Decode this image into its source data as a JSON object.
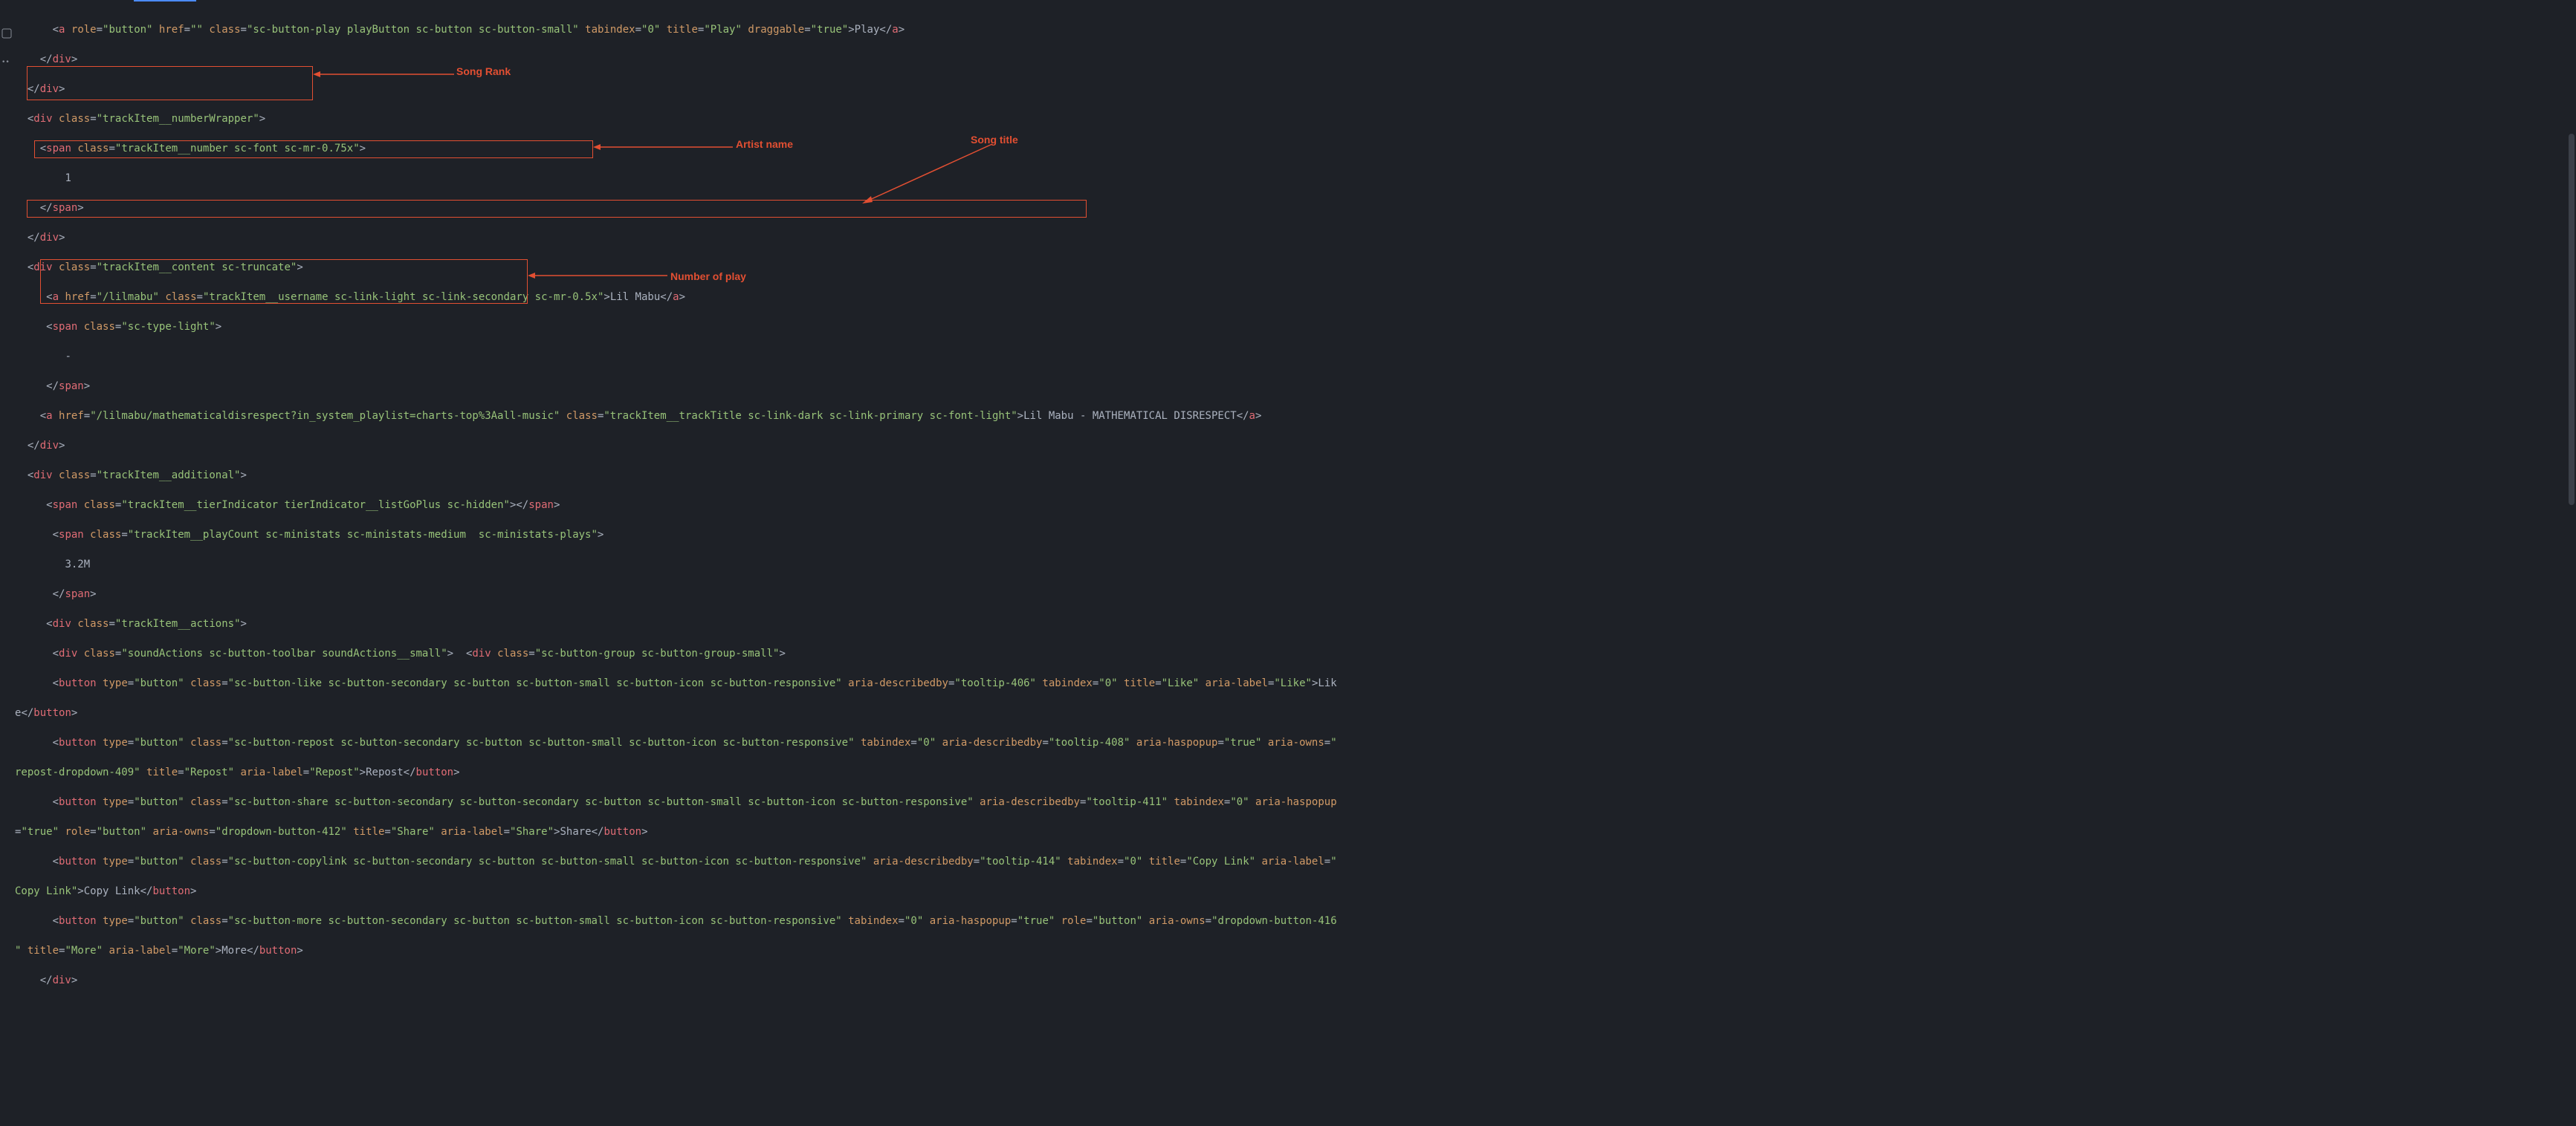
{
  "annotations": {
    "song_rank": "Song Rank",
    "artist_name": "Artist name",
    "song_title": "Song title",
    "play_count": "Number of play"
  },
  "code": {
    "l0": {
      "ind": "      ",
      "open": "<",
      "tag": "a",
      "attrs": " role=\"button\" href=\"\" class=\"sc-button-play playButton sc-button sc-button-small\" tabindex=\"0\" title=\"Play\" draggable=\"true\"",
      "close": ">",
      "text": "Play",
      "endopen": "</",
      "endtag": "a",
      "endclose": ">"
    },
    "l1": {
      "ind": "    ",
      "open": "</",
      "tag": "div",
      "close": ">"
    },
    "l2": {
      "ind": "  ",
      "open": "</",
      "tag": "div",
      "close": ">"
    },
    "l3": {
      "ind": "  ",
      "open": "<",
      "tag": "div",
      "attrs": " class=\"trackItem__numberWrapper\"",
      "close": ">"
    },
    "l4": {
      "ind": "    ",
      "open": "<",
      "tag": "span",
      "attrs": " class=\"trackItem__number sc-font sc-mr-0.75x\"",
      "close": ">"
    },
    "l5": {
      "ind": "        ",
      "text": "1"
    },
    "l6": {
      "ind": "    ",
      "open": "</",
      "tag": "span",
      "close": ">"
    },
    "l7": {
      "ind": "  ",
      "open": "</",
      "tag": "div",
      "close": ">"
    },
    "l8": {
      "ind": "  ",
      "open": "<",
      "tag": "div",
      "attrs": " class=\"trackItem__content sc-truncate\"",
      "close": ">"
    },
    "l9": {
      "ind": "     ",
      "open": "<",
      "tag": "a",
      "attrs": " href=\"/lilmabu\" class=\"trackItem__username sc-link-light sc-link-secondary sc-mr-0.5x\"",
      "close": ">",
      "text": "Lil Mabu",
      "endopen": "</",
      "endtag": "a",
      "endclose": ">"
    },
    "l10": {
      "ind": "     ",
      "open": "<",
      "tag": "span",
      "attrs": " class=\"sc-type-light\"",
      "close": ">"
    },
    "l11": {
      "ind": "        ",
      "text": "-"
    },
    "l12": {
      "ind": "     ",
      "open": "</",
      "tag": "span",
      "close": ">"
    },
    "l13": {
      "ind": "    ",
      "open": "<",
      "tag": "a",
      "attrs": " href=\"/lilmabu/mathematicaldisrespect?in_system_playlist=charts-top%3Aall-music\" class=\"trackItem__trackTitle sc-link-dark sc-link-primary sc-font-light\"",
      "close": ">",
      "text": "Lil Mabu - MATHEMATICAL DISRESPECT",
      "endopen": "</",
      "endtag": "a",
      "endclose": ">"
    },
    "l14": {
      "ind": "  ",
      "open": "</",
      "tag": "div",
      "close": ">"
    },
    "l15": {
      "ind": "  ",
      "open": "<",
      "tag": "div",
      "attrs": " class=\"trackItem__additional\"",
      "close": ">"
    },
    "l16": {
      "ind": "     ",
      "open": "<",
      "tag": "span",
      "attrs": " class=\"trackItem__tierIndicator tierIndicator__listGoPlus sc-hidden\"",
      "close": ">",
      "endopen": "</",
      "endtag": "span",
      "endclose": ">"
    },
    "l17": {
      "ind": "      ",
      "open": "<",
      "tag": "span",
      "attrs": " class=\"trackItem__playCount sc-ministats sc-ministats-medium  sc-ministats-plays\"",
      "close": ">"
    },
    "l18": {
      "ind": "        ",
      "text": "3.2M"
    },
    "l19": {
      "ind": "      ",
      "open": "</",
      "tag": "span",
      "close": ">"
    },
    "l20": {
      "ind": "     ",
      "open": "<",
      "tag": "div",
      "attrs": " class=\"trackItem__actions\"",
      "close": ">"
    },
    "l21": {
      "ind": "      ",
      "open": "<",
      "tag": "div",
      "attrs": " class=\"soundActions sc-button-toolbar soundActions__small\"",
      "close": ">",
      "sep": "  ",
      "open2": "<",
      "tag2": "div",
      "attrs2": " class=\"sc-button-group sc-button-group-small\"",
      "close2": ">"
    },
    "l22": {
      "ind": "      ",
      "open": "<",
      "tag": "button",
      "attrs": " type=\"button\" class=\"sc-button-like sc-button-secondary sc-button sc-button-small sc-button-icon sc-button-responsive\" aria-describedby=\"tooltip-406\" tabindex=\"0\" title=\"Like\" aria-label=\"Like\"",
      "close": ">",
      "text": "Lik"
    },
    "l23": {
      "ind": "",
      "text": "e",
      "endopen": "</",
      "endtag": "button",
      "endclose": ">"
    },
    "l24": {
      "ind": "      ",
      "open": "<",
      "tag": "button",
      "attrs": " type=\"button\" class=\"sc-button-repost sc-button-secondary sc-button sc-button-small sc-button-icon sc-button-responsive\" tabindex=\"0\" aria-describedby=\"tooltip-408\" aria-haspopup=\"true\" aria-owns=\""
    },
    "l25": {
      "ind": "",
      "rawstr": "repost-dropdown-409\" title=\"Repost\" aria-label=\"Repost\"",
      "close": ">",
      "text": "Repost",
      "endopen": "</",
      "endtag": "button",
      "endclose": ">"
    },
    "l26": {
      "ind": "      ",
      "open": "<",
      "tag": "button",
      "attrs": " type=\"button\" class=\"sc-button-share sc-button-secondary sc-button-secondary sc-button sc-button-small sc-button-icon sc-button-responsive\" aria-describedby=\"tooltip-411\" tabindex=\"0\" aria-haspopup"
    },
    "l27": {
      "ind": "",
      "rawattr": "=\"true\" role=\"button\" aria-owns=\"dropdown-button-412\" title=\"Share\" aria-label=\"Share\"",
      "close": ">",
      "text": "Share",
      "endopen": "</",
      "endtag": "button",
      "endclose": ">"
    },
    "l28": {
      "ind": "      ",
      "open": "<",
      "tag": "button",
      "attrs": " type=\"button\" class=\"sc-button-copylink sc-button-secondary sc-button sc-button-small sc-button-icon sc-button-responsive\" aria-describedby=\"tooltip-414\" tabindex=\"0\" title=\"Copy Link\" aria-label=\""
    },
    "l29": {
      "ind": "",
      "rawstr": "Copy Link\"",
      "close": ">",
      "text": "Copy Link",
      "endopen": "</",
      "endtag": "button",
      "endclose": ">"
    },
    "l30": {
      "ind": "      ",
      "open": "<",
      "tag": "button",
      "attrs": " type=\"button\" class=\"sc-button-more sc-button-secondary sc-button sc-button-small sc-button-icon sc-button-responsive\" tabindex=\"0\" aria-haspopup=\"true\" role=\"button\" aria-owns=\"dropdown-button-416"
    },
    "l31": {
      "ind": "",
      "rawstr": "\" title=\"More\" aria-label=\"More\"",
      "close": ">",
      "text": "More",
      "endopen": "</",
      "endtag": "button",
      "endclose": ">"
    },
    "l32": {
      "ind": "    ",
      "open": "</",
      "tag": "div",
      "close": ">"
    }
  }
}
